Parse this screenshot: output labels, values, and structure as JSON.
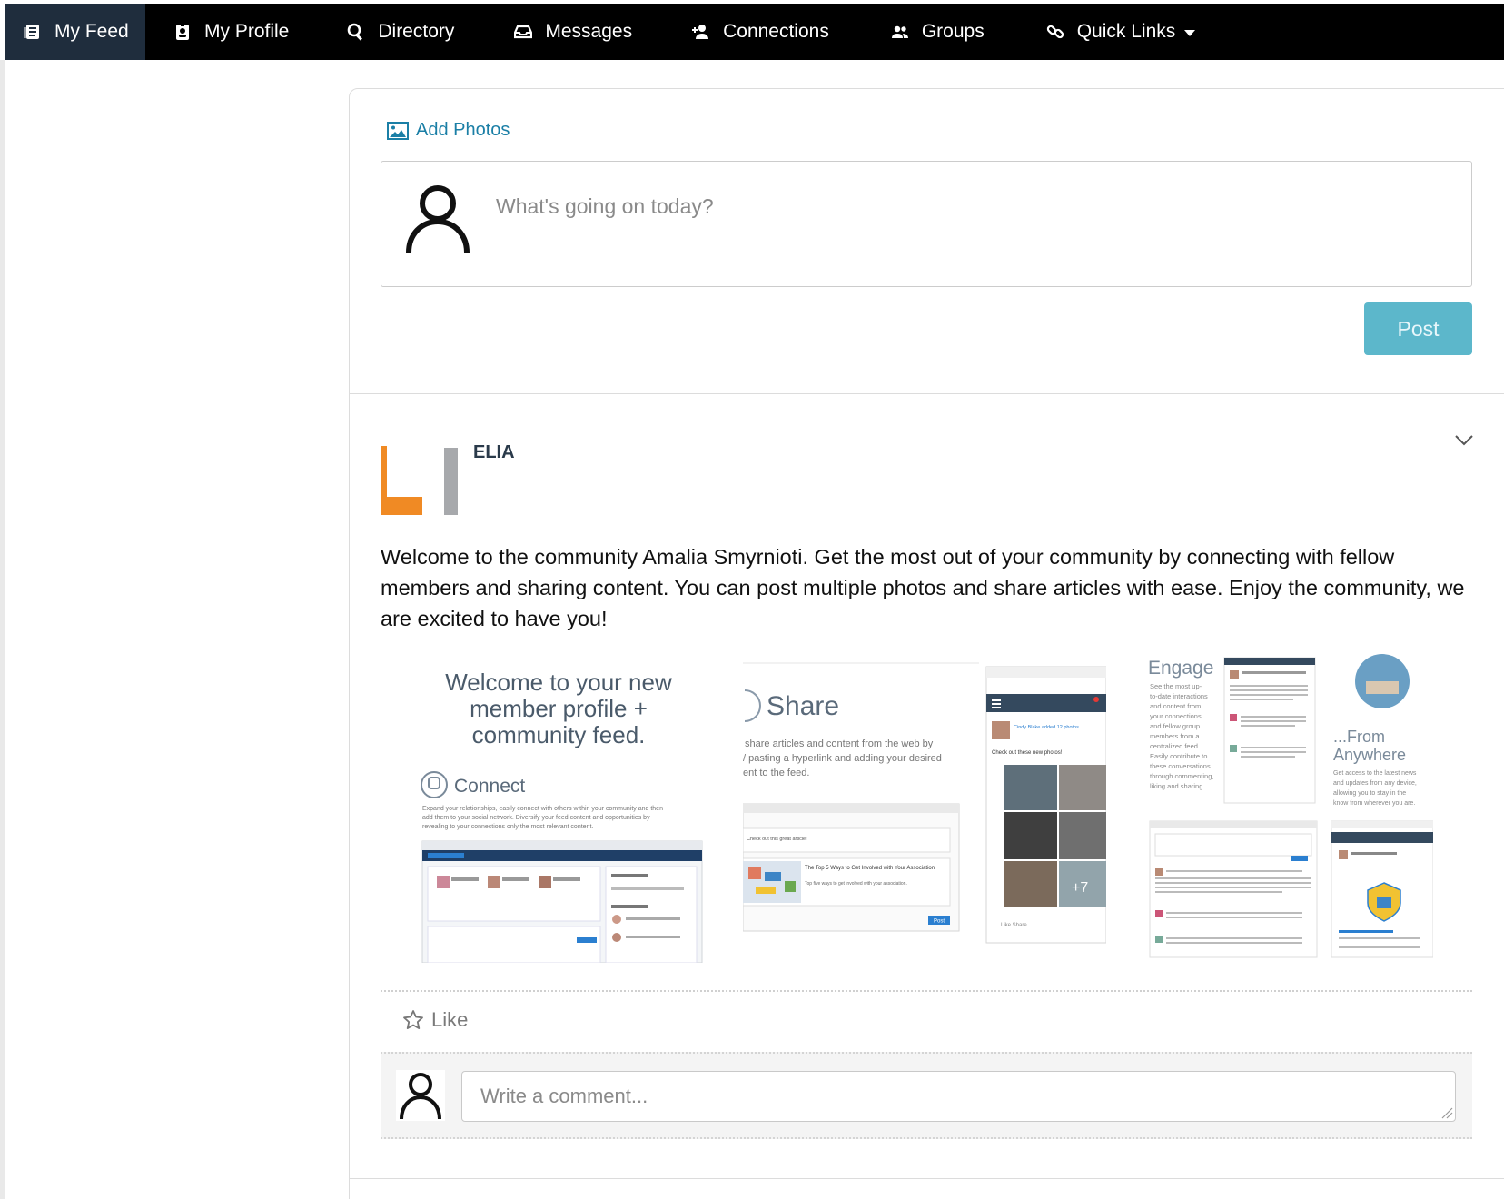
{
  "nav": {
    "items": [
      {
        "label": "My Feed",
        "icon": "newspaper-icon"
      },
      {
        "label": "My Profile",
        "icon": "id-badge-icon"
      },
      {
        "label": "Directory",
        "icon": "search-icon"
      },
      {
        "label": "Messages",
        "icon": "inbox-icon"
      },
      {
        "label": "Connections",
        "icon": "user-plus-icon"
      },
      {
        "label": "Groups",
        "icon": "users-icon"
      },
      {
        "label": "Quick Links",
        "icon": "link-icon"
      }
    ],
    "active": "My Feed"
  },
  "composer": {
    "add_photos_label": "Add Photos",
    "placeholder": "What's going on today?",
    "post_label": "Post"
  },
  "post": {
    "author": "ELIA",
    "body": "Welcome to the community Amalia Smyrnioti. Get the most out of your community by connecting with fellow members and sharing content. You can post multiple photos and share articles with ease. Enjoy the community, we are excited to have you!",
    "media": {
      "card1": {
        "heading": "Welcome to your new member profile + community feed.",
        "heading_lines": [
          "Welcome to your new",
          "member profile +",
          "community feed."
        ],
        "section": "Connect",
        "desc_lines": [
          "Expand your relationships, easily connect with others within your community and then",
          "add them to your social network. Diversify your feed content and opportunities by",
          "revealing to your connections only the most relevant content."
        ]
      },
      "card2": {
        "section": "Share",
        "desc_lines": [
          "share articles and content from the web by",
          "/ pasting a hyperlink and adding your desired",
          "ent to the feed."
        ],
        "post_caption": "Check out these new photos!",
        "poster": "Cindy Blake added 12 photos",
        "comment_hint": "Check out this great article!",
        "article_title": "The Top 5 Ways to Get Involved with Your Association",
        "article_sub": "Top five ways to get involved with your association.",
        "more_count": "+7",
        "actions": "Like  Share",
        "btn": "Post"
      },
      "card3": {
        "section1": "Engage",
        "desc1_lines": [
          "See the most up-",
          "to-date interactions",
          "and content from",
          "your connections",
          "and fellow group",
          "members from a",
          "centralized feed.",
          "Easily contribute to",
          "these conversations",
          "through commenting,",
          "liking and sharing."
        ],
        "section2_lines": [
          "...From",
          "Anywhere"
        ],
        "desc2_lines": [
          "Get access to the latest news",
          "and updates from any device,",
          "allowing you to stay in the",
          "know from wherever you are."
        ]
      }
    }
  },
  "actions": {
    "like_label": "Like",
    "comment_placeholder": "Write a comment..."
  },
  "colors": {
    "nav_bg": "#000000",
    "nav_active": "#1f2d3d",
    "accent_link": "#1b7fa6",
    "post_button": "#5cb7cb",
    "logo_orange": "#f08a24",
    "logo_gray": "#a7a9ac"
  }
}
